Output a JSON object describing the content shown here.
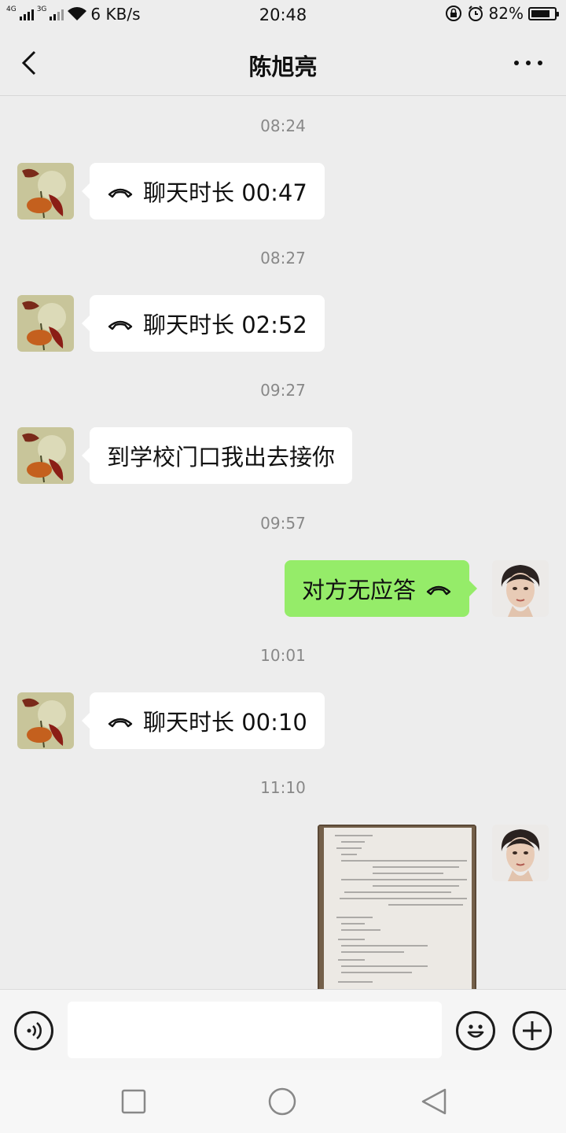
{
  "status_bar": {
    "network_1": "4G",
    "network_2": "3G",
    "speed": "6 KB/s",
    "time": "20:48",
    "battery_text": "82%",
    "battery_level": 0.82
  },
  "header": {
    "title": "陈旭亮"
  },
  "messages": [
    {
      "timestamp": "08:24",
      "sender": "contact",
      "type": "call",
      "text": "聊天时长 00:47"
    },
    {
      "timestamp": "08:27",
      "sender": "contact",
      "type": "call",
      "text": "聊天时长 02:52"
    },
    {
      "timestamp": "09:27",
      "sender": "contact",
      "type": "text",
      "text": "到学校门口我出去接你"
    },
    {
      "timestamp": "09:57",
      "sender": "me",
      "type": "call",
      "text": "对方无应答"
    },
    {
      "timestamp": "10:01",
      "sender": "contact",
      "type": "call",
      "text": "聊天时长 00:10"
    },
    {
      "timestamp": "11:10",
      "sender": "me",
      "type": "image",
      "text": ""
    }
  ],
  "icons": {
    "back": "back-arrow-icon",
    "more": "more-dots-icon",
    "voice": "voice-input-icon",
    "emoji": "emoji-icon",
    "plus": "plus-icon",
    "call": "phone-hangup-icon"
  },
  "colors": {
    "background": "#ededed",
    "outgoing_bubble": "#95ec69",
    "incoming_bubble": "#ffffff",
    "timestamp": "#888888"
  }
}
